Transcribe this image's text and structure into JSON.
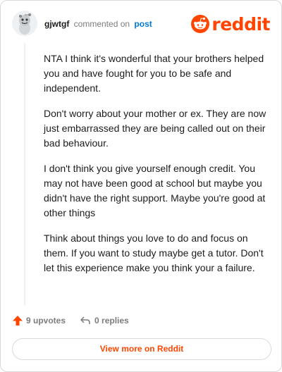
{
  "comment": {
    "username": "gjwtgf",
    "action": "commented on",
    "post_link": "post",
    "avatar_icon": "snoo-avatar-icon",
    "paragraphs": [
      "NTA I think it's wonderful that your brothers helped you and have fought for you to be safe and independent.",
      "Don't worry about your mother or ex. They are now just embarrassed they are being called out on their bad behaviour.",
      "I don't think you give yourself enough credit. You may not have been good at school but maybe you didn't have the right support. Maybe you're good at other things",
      "Think about things you love to do and focus on them. If you want to study maybe get a tutor. Don't let this experience make you think your a failure."
    ]
  },
  "branding": {
    "logo_text": "reddit",
    "brand_color": "#ff4500"
  },
  "footer": {
    "upvotes_label": "9 upvotes",
    "replies_label": "0 replies",
    "upvote_icon": "upvote-arrow-icon",
    "reply_icon": "reply-arrow-icon"
  },
  "cta": {
    "label": "View more on Reddit"
  }
}
